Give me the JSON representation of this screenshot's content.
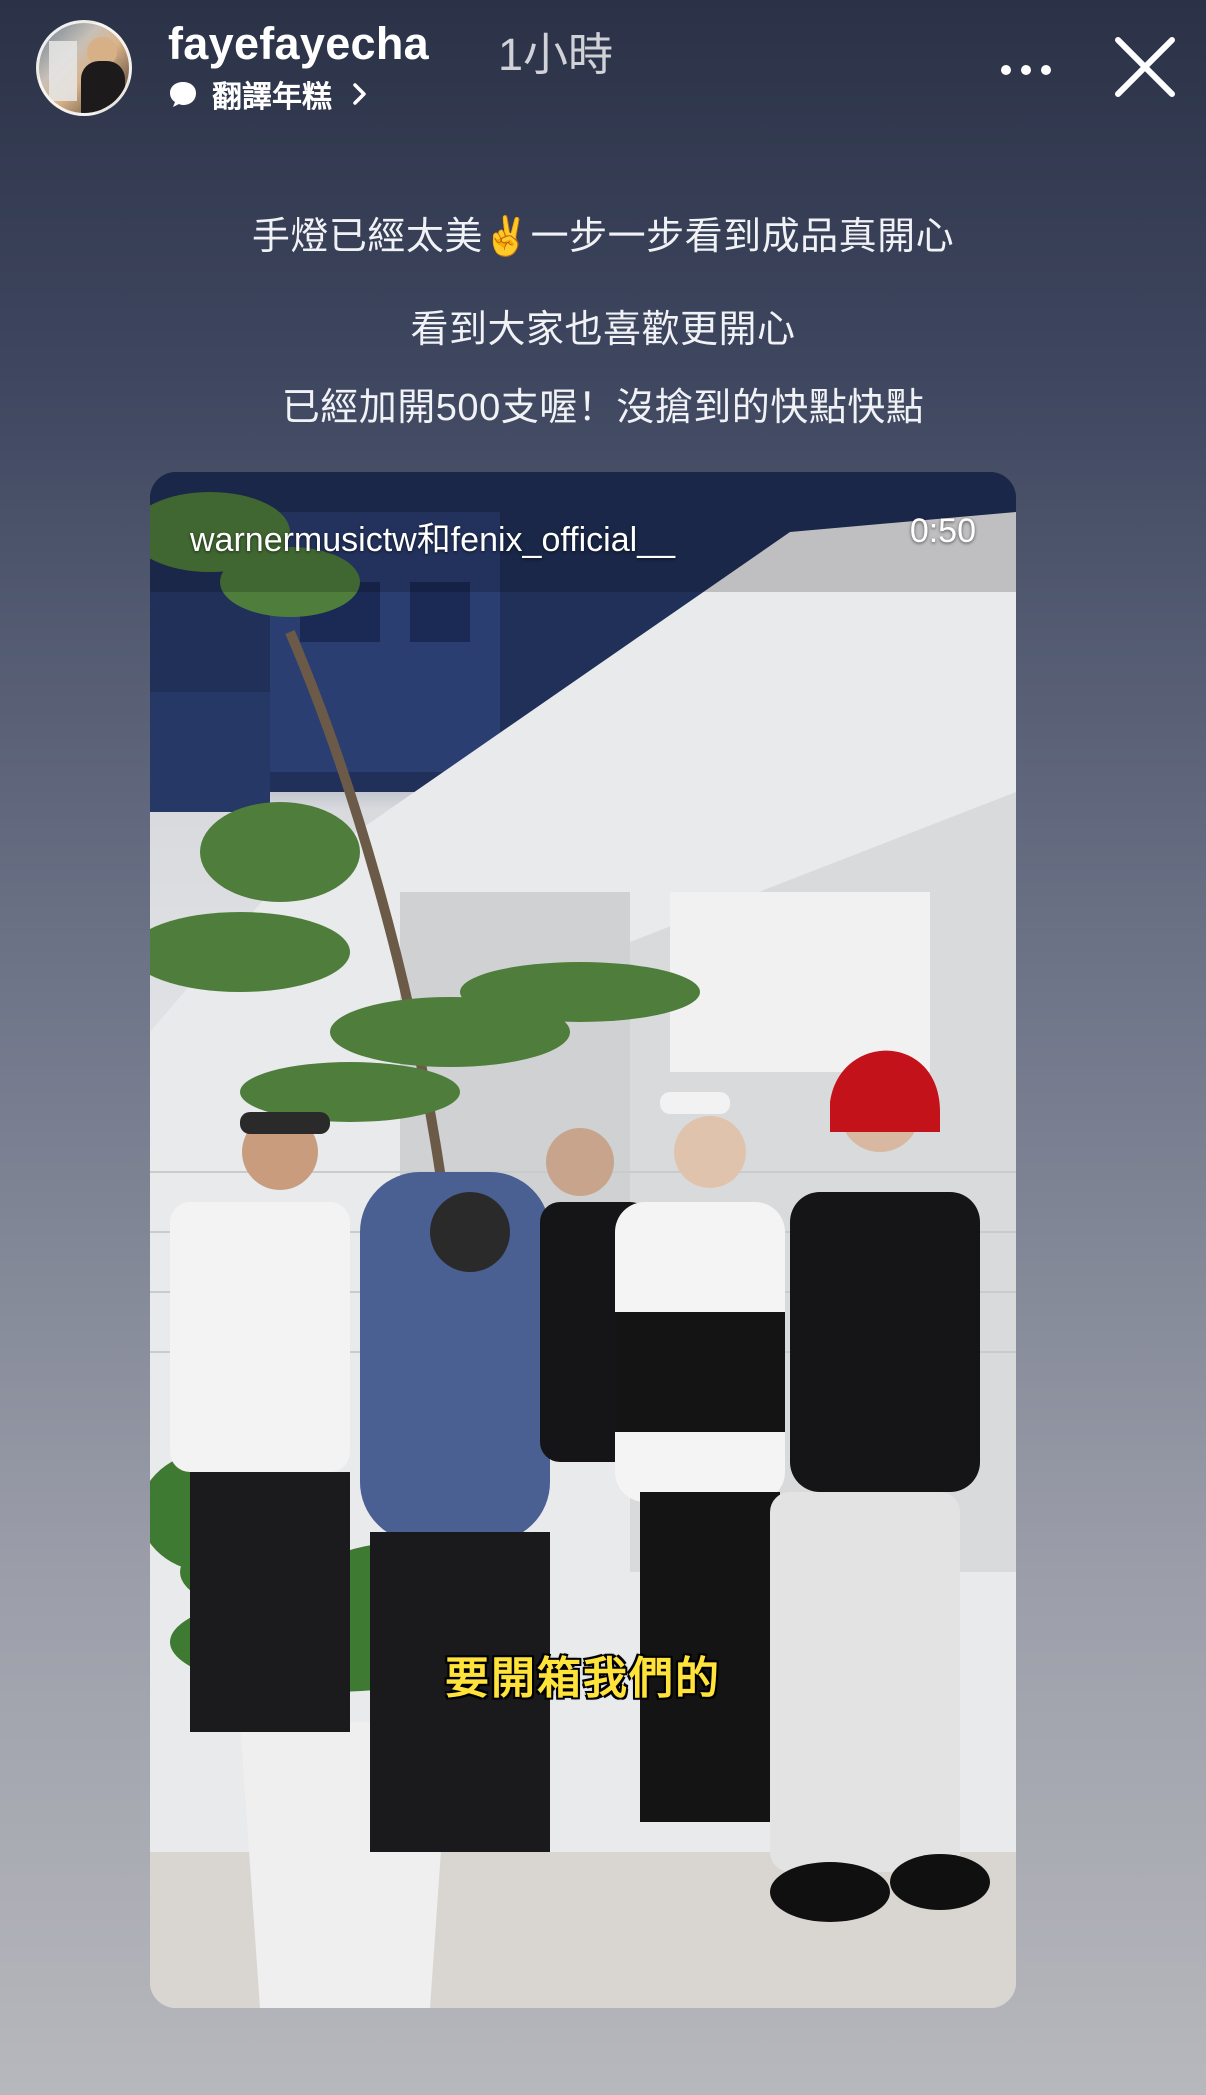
{
  "header": {
    "username": "fayefayecha",
    "time": "1小時",
    "translate_label": "翻譯年糕",
    "more_icon": "more-horizontal-icon",
    "close_icon": "close-icon"
  },
  "caption": {
    "line1": "手燈已經太美✌️一步一步看到成品真開心",
    "line2": "看到大家也喜歡更開心",
    "line3": "已經加開500支喔！沒搶到的快點快點"
  },
  "video": {
    "source": "warnermusictw和fenix_official__",
    "duration": "0:50",
    "subtitle": "要開箱我們的"
  },
  "colors": {
    "background_top": "#2b3247",
    "background_bottom": "#b7b8bd",
    "subtitle_yellow": "#ffe23a"
  }
}
